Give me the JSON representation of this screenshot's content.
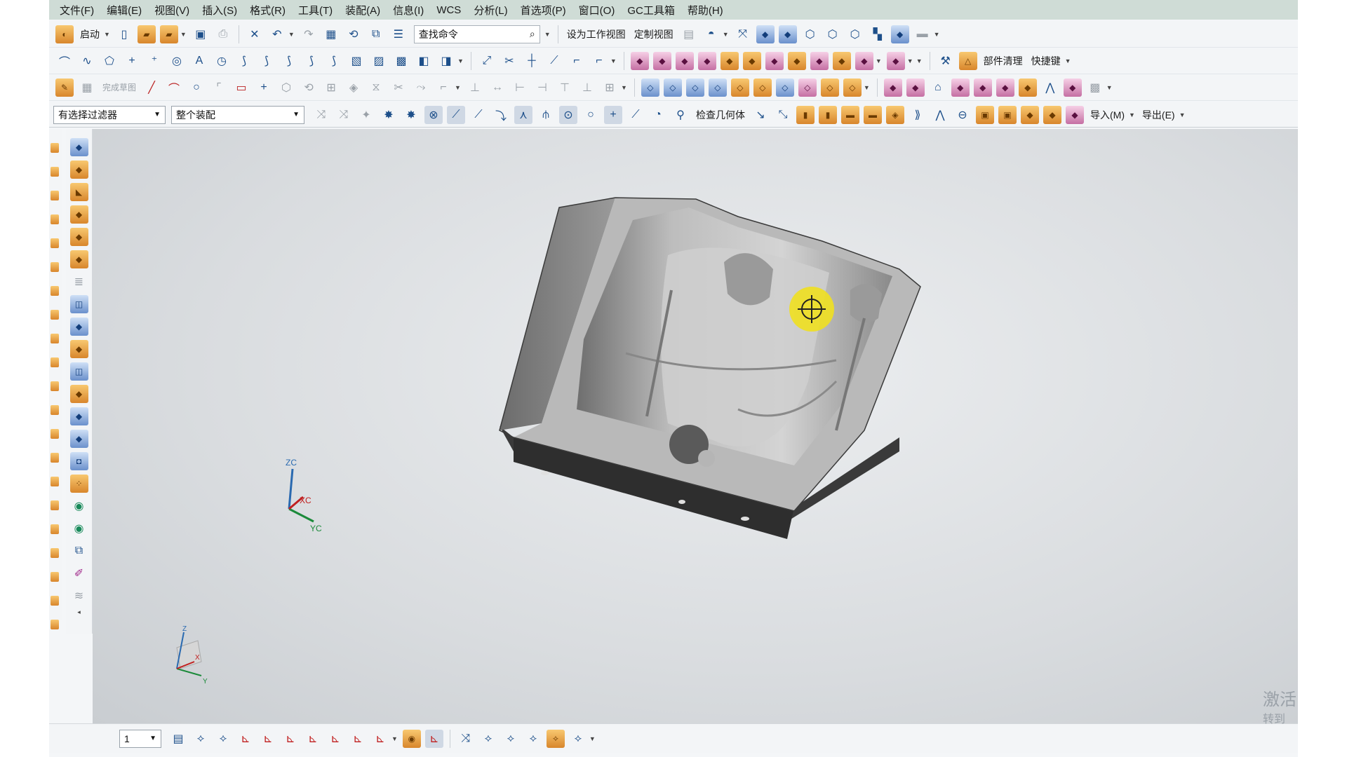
{
  "menu": [
    "文件(F)",
    "编辑(E)",
    "视图(V)",
    "插入(S)",
    "格式(R)",
    "工具(T)",
    "装配(A)",
    "信息(I)",
    "WCS",
    "分析(L)",
    "首选项(P)",
    "窗口(O)",
    "GC工具箱",
    "帮助(H)"
  ],
  "toolbar1": {
    "start_label": "启动",
    "search_placeholder": "查找命令",
    "set_work_view": "设为工作视图",
    "customize_view": "定制视图"
  },
  "toolbar2": {
    "part_cleanup": "部件清理",
    "shortcut": "快捷键"
  },
  "toolbar3": {
    "finish_sketch": "完成草图"
  },
  "toolbar4": {
    "selection_filter": "有选择过滤器",
    "assembly_scope": "整个装配",
    "check_geometry": "检查几何体",
    "import_label": "导入(M)",
    "export_label": "导出(E)"
  },
  "viewport": {
    "wcs_axes": {
      "z": "ZC",
      "x": "XC",
      "y": "YC"
    },
    "abs_axes": {
      "z": "Z",
      "x": "X",
      "y": "Y"
    }
  },
  "bottom": {
    "layer_value": "1"
  },
  "watermark": {
    "line1": "激活",
    "line2": "转到"
  },
  "colors": {
    "menubar": "#cfdcd6",
    "accent": "#1d4f8a",
    "cursor_highlight": "#f0e020"
  }
}
